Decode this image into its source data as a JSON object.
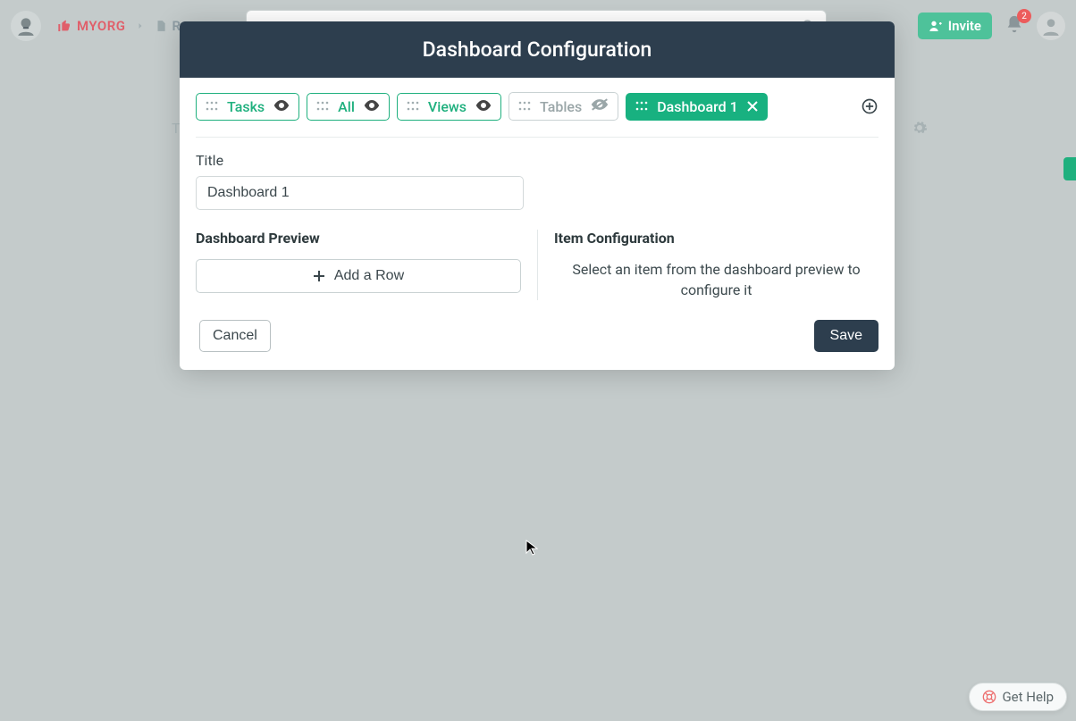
{
  "topbar": {
    "org": "MYORG",
    "crumb2": "R",
    "invite": "Invite",
    "badge": "2"
  },
  "background": {
    "tab_fragment": "Ta"
  },
  "modal": {
    "title": "Dashboard Configuration",
    "tabs": {
      "tasks": "Tasks",
      "all": "All",
      "views": "Views",
      "tables": "Tables",
      "dashboard1": "Dashboard 1"
    },
    "fields": {
      "title_label": "Title",
      "title_value": "Dashboard 1",
      "preview_label": "Dashboard Preview",
      "add_row": "Add a Row",
      "item_config_label": "Item Configuration",
      "item_config_help": "Select an item from the dashboard preview to configure it"
    },
    "footer": {
      "cancel": "Cancel",
      "save": "Save"
    }
  },
  "help": {
    "label": "Get Help"
  }
}
